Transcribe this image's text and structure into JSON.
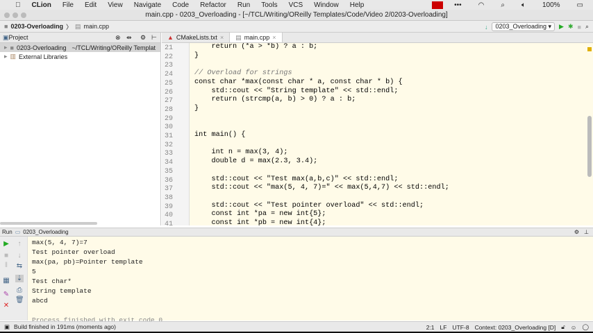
{
  "menubar": {
    "app": "CLion",
    "items": [
      "File",
      "Edit",
      "View",
      "Navigate",
      "Code",
      "Refactor",
      "Run",
      "Tools",
      "VCS",
      "Window",
      "Help"
    ],
    "battery": "100%"
  },
  "window": {
    "title": "main.cpp - 0203_Overloading - [~/TCL/Writing/OReilly Templates/Code/Video 2/0203-Overloading]"
  },
  "navbar": {
    "crumbs": [
      "0203-Overloading",
      "main.cpp"
    ],
    "run_config": "0203_Overloading"
  },
  "project": {
    "header": "Project",
    "items": [
      {
        "label": "0203-Overloading",
        "path": "~/TCL/Writing/OReilly Templat"
      },
      {
        "label": "External Libraries"
      }
    ]
  },
  "tabs": [
    {
      "label": "CMakeLists.txt"
    },
    {
      "label": "main.cpp",
      "active": true
    }
  ],
  "editor": {
    "lines": [
      {
        "n": "21",
        "t": "    return (*a > *b) ? a : b;"
      },
      {
        "n": "22",
        "t": "}"
      },
      {
        "n": "23",
        "t": ""
      },
      {
        "n": "24",
        "t": "// Overload for strings"
      },
      {
        "n": "25",
        "t": "const char *max(const char * a, const char * b) {"
      },
      {
        "n": "26",
        "t": "    std::cout << \"String template\" << std::endl;"
      },
      {
        "n": "27",
        "t": "    return (strcmp(a, b) > 0) ? a : b;"
      },
      {
        "n": "28",
        "t": "}"
      },
      {
        "n": "29",
        "t": ""
      },
      {
        "n": "30",
        "t": ""
      },
      {
        "n": "31",
        "t": "int main() {"
      },
      {
        "n": "32",
        "t": ""
      },
      {
        "n": "33",
        "t": "    int n = max(3, 4);"
      },
      {
        "n": "34",
        "t": "    double d = max(2.3, 3.4);"
      },
      {
        "n": "35",
        "t": ""
      },
      {
        "n": "36",
        "t": "    std::cout << \"Test max(a,b,c)\" << std::endl;"
      },
      {
        "n": "37",
        "t": "    std::cout << \"max(5, 4, 7)=\" << max(5,4,7) << std::endl;"
      },
      {
        "n": "38",
        "t": ""
      },
      {
        "n": "39",
        "t": "    std::cout << \"Test pointer overload\" << std::endl;"
      },
      {
        "n": "40",
        "t": "    const int *pa = new int{5};"
      },
      {
        "n": "41",
        "t": "    const int *pb = new int{4};"
      }
    ]
  },
  "run": {
    "label": "Run",
    "config": "0203_Overloading",
    "output": [
      "max(5, 4, 7)=7",
      "Test pointer overload",
      "max(pa, pb)=Pointer template",
      "5",
      "Test char*",
      "String template",
      "abcd",
      "",
      "Process finished with exit code 0"
    ]
  },
  "status": {
    "message": "Build finished in 191ms (moments ago)",
    "position": "2:1",
    "line_ending": "LF",
    "encoding": "UTF-8",
    "context": "Context: 0203_Overloading [D]"
  }
}
